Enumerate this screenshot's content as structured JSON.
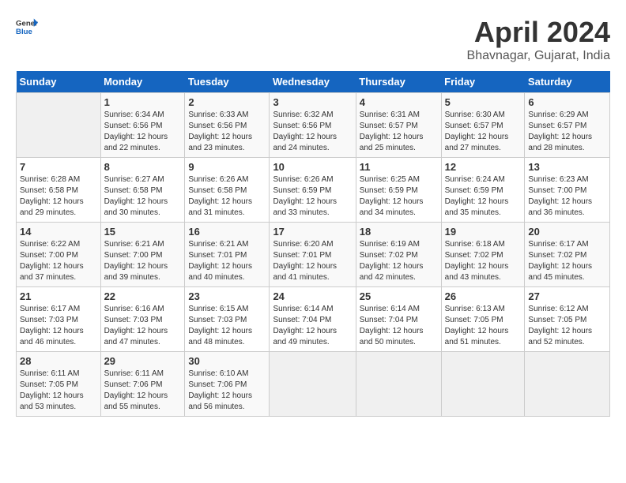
{
  "header": {
    "logo_general": "General",
    "logo_blue": "Blue",
    "title": "April 2024",
    "subtitle": "Bhavnagar, Gujarat, India"
  },
  "calendar": {
    "days_of_week": [
      "Sunday",
      "Monday",
      "Tuesday",
      "Wednesday",
      "Thursday",
      "Friday",
      "Saturday"
    ],
    "weeks": [
      [
        {
          "day": "",
          "info": ""
        },
        {
          "day": "1",
          "info": "Sunrise: 6:34 AM\nSunset: 6:56 PM\nDaylight: 12 hours\nand 22 minutes."
        },
        {
          "day": "2",
          "info": "Sunrise: 6:33 AM\nSunset: 6:56 PM\nDaylight: 12 hours\nand 23 minutes."
        },
        {
          "day": "3",
          "info": "Sunrise: 6:32 AM\nSunset: 6:56 PM\nDaylight: 12 hours\nand 24 minutes."
        },
        {
          "day": "4",
          "info": "Sunrise: 6:31 AM\nSunset: 6:57 PM\nDaylight: 12 hours\nand 25 minutes."
        },
        {
          "day": "5",
          "info": "Sunrise: 6:30 AM\nSunset: 6:57 PM\nDaylight: 12 hours\nand 27 minutes."
        },
        {
          "day": "6",
          "info": "Sunrise: 6:29 AM\nSunset: 6:57 PM\nDaylight: 12 hours\nand 28 minutes."
        }
      ],
      [
        {
          "day": "7",
          "info": "Sunrise: 6:28 AM\nSunset: 6:58 PM\nDaylight: 12 hours\nand 29 minutes."
        },
        {
          "day": "8",
          "info": "Sunrise: 6:27 AM\nSunset: 6:58 PM\nDaylight: 12 hours\nand 30 minutes."
        },
        {
          "day": "9",
          "info": "Sunrise: 6:26 AM\nSunset: 6:58 PM\nDaylight: 12 hours\nand 31 minutes."
        },
        {
          "day": "10",
          "info": "Sunrise: 6:26 AM\nSunset: 6:59 PM\nDaylight: 12 hours\nand 33 minutes."
        },
        {
          "day": "11",
          "info": "Sunrise: 6:25 AM\nSunset: 6:59 PM\nDaylight: 12 hours\nand 34 minutes."
        },
        {
          "day": "12",
          "info": "Sunrise: 6:24 AM\nSunset: 6:59 PM\nDaylight: 12 hours\nand 35 minutes."
        },
        {
          "day": "13",
          "info": "Sunrise: 6:23 AM\nSunset: 7:00 PM\nDaylight: 12 hours\nand 36 minutes."
        }
      ],
      [
        {
          "day": "14",
          "info": "Sunrise: 6:22 AM\nSunset: 7:00 PM\nDaylight: 12 hours\nand 37 minutes."
        },
        {
          "day": "15",
          "info": "Sunrise: 6:21 AM\nSunset: 7:00 PM\nDaylight: 12 hours\nand 39 minutes."
        },
        {
          "day": "16",
          "info": "Sunrise: 6:21 AM\nSunset: 7:01 PM\nDaylight: 12 hours\nand 40 minutes."
        },
        {
          "day": "17",
          "info": "Sunrise: 6:20 AM\nSunset: 7:01 PM\nDaylight: 12 hours\nand 41 minutes."
        },
        {
          "day": "18",
          "info": "Sunrise: 6:19 AM\nSunset: 7:02 PM\nDaylight: 12 hours\nand 42 minutes."
        },
        {
          "day": "19",
          "info": "Sunrise: 6:18 AM\nSunset: 7:02 PM\nDaylight: 12 hours\nand 43 minutes."
        },
        {
          "day": "20",
          "info": "Sunrise: 6:17 AM\nSunset: 7:02 PM\nDaylight: 12 hours\nand 45 minutes."
        }
      ],
      [
        {
          "day": "21",
          "info": "Sunrise: 6:17 AM\nSunset: 7:03 PM\nDaylight: 12 hours\nand 46 minutes."
        },
        {
          "day": "22",
          "info": "Sunrise: 6:16 AM\nSunset: 7:03 PM\nDaylight: 12 hours\nand 47 minutes."
        },
        {
          "day": "23",
          "info": "Sunrise: 6:15 AM\nSunset: 7:03 PM\nDaylight: 12 hours\nand 48 minutes."
        },
        {
          "day": "24",
          "info": "Sunrise: 6:14 AM\nSunset: 7:04 PM\nDaylight: 12 hours\nand 49 minutes."
        },
        {
          "day": "25",
          "info": "Sunrise: 6:14 AM\nSunset: 7:04 PM\nDaylight: 12 hours\nand 50 minutes."
        },
        {
          "day": "26",
          "info": "Sunrise: 6:13 AM\nSunset: 7:05 PM\nDaylight: 12 hours\nand 51 minutes."
        },
        {
          "day": "27",
          "info": "Sunrise: 6:12 AM\nSunset: 7:05 PM\nDaylight: 12 hours\nand 52 minutes."
        }
      ],
      [
        {
          "day": "28",
          "info": "Sunrise: 6:11 AM\nSunset: 7:05 PM\nDaylight: 12 hours\nand 53 minutes."
        },
        {
          "day": "29",
          "info": "Sunrise: 6:11 AM\nSunset: 7:06 PM\nDaylight: 12 hours\nand 55 minutes."
        },
        {
          "day": "30",
          "info": "Sunrise: 6:10 AM\nSunset: 7:06 PM\nDaylight: 12 hours\nand 56 minutes."
        },
        {
          "day": "",
          "info": ""
        },
        {
          "day": "",
          "info": ""
        },
        {
          "day": "",
          "info": ""
        },
        {
          "day": "",
          "info": ""
        }
      ]
    ]
  }
}
